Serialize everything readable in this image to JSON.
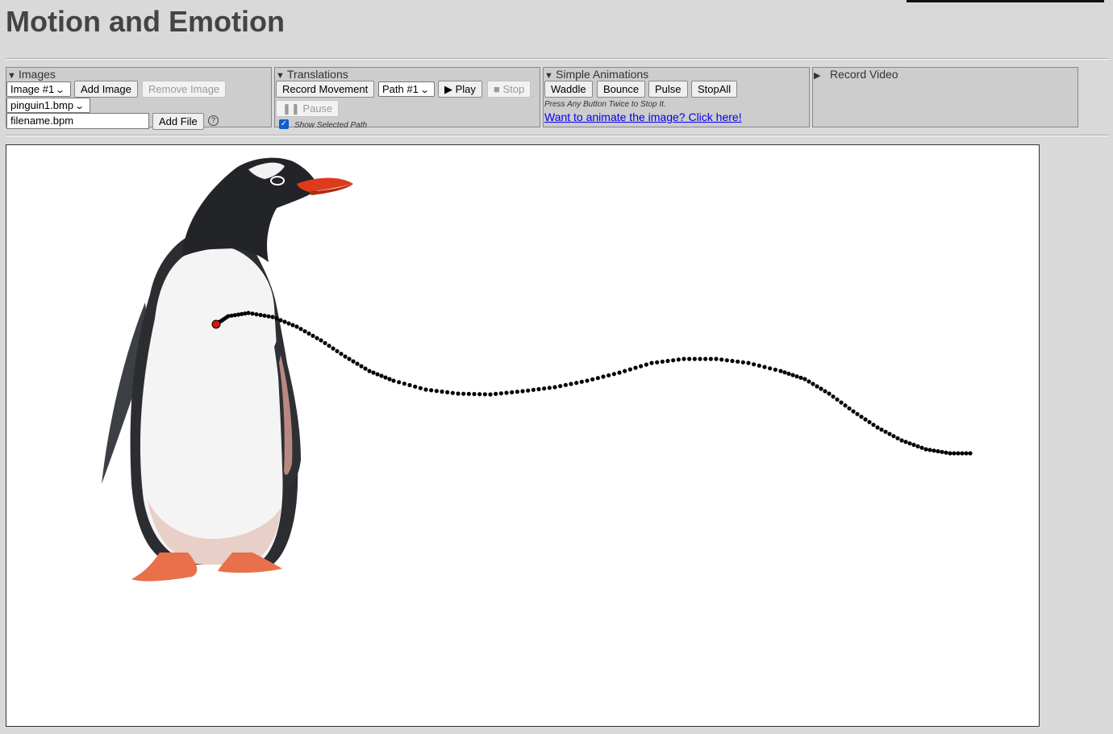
{
  "title": "Motion and Emotion",
  "images_panel": {
    "legend": "Images",
    "image_select": "Image #1",
    "add_image": "Add Image",
    "remove_image": "Remove Image",
    "file_select": "pinguin1.bmp",
    "filename_value": "filename.bpm",
    "add_file": "Add File",
    "help": "?"
  },
  "translations_panel": {
    "legend": "Translations",
    "record_movement": "Record Movement",
    "path_select": "Path #1",
    "play": "▶ Play",
    "stop": "■ Stop",
    "pause": "❚❚ Pause",
    "show_selected_path": "Show Selected Path",
    "show_selected_path_checked": true
  },
  "animations_panel": {
    "legend": "Simple Animations",
    "waddle": "Waddle",
    "bounce": "Bounce",
    "pulse": "Pulse",
    "stopall": "StopAll",
    "hint": "Press Any Button Twice to Stop It.",
    "link": "Want to animate the image? Click here!"
  },
  "record_panel": {
    "legend": "Record Video"
  },
  "colors": {
    "background": "#d9d9d9",
    "panel": "#cdcdcd",
    "path_dot": "#000000",
    "path_start": "#e01010",
    "link": "#0000ee"
  }
}
